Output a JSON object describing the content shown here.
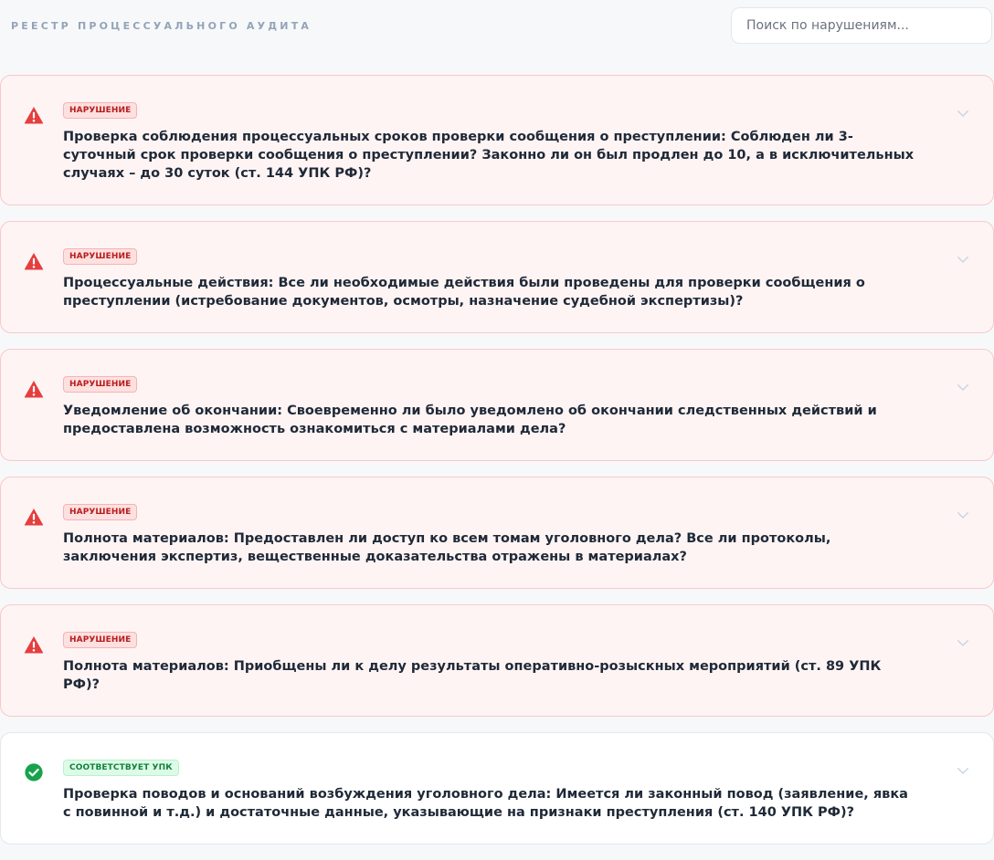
{
  "header": {
    "title": "РЕЕСТР ПРОЦЕССУАЛЬНОГО АУДИТА",
    "search_placeholder": "Поиск по нарушениям..."
  },
  "colors": {
    "violation_icon": "#e53e3e",
    "ok_icon": "#16a34a",
    "chevron": "#cbd5e1"
  },
  "items": [
    {
      "status": "violation",
      "badge": "НАРУШЕНИЕ",
      "text": "Проверка соблюдения процессуальных сроков проверки сообщения о преступлении: Соблюден ли 3-суточный срок проверки сообщения о преступлении? Законно ли он был продлен до 10, а в исключительных случаях – до 30 суток (ст. 144 УПК РФ)?",
      "icon": "warning-triangle-icon"
    },
    {
      "status": "violation",
      "badge": "НАРУШЕНИЕ",
      "text": "Процессуальные действия: Все ли необходимые действия были проведены для проверки сообщения о преступлении (истребование документов, осмотры, назначение судебной экспертизы)?",
      "icon": "warning-triangle-icon"
    },
    {
      "status": "violation",
      "badge": "НАРУШЕНИЕ",
      "text": "Уведомление об окончании: Своевременно ли было уведомлено об окончании следственных действий и предоставлена возможность ознакомиться с материалами дела?",
      "icon": "warning-triangle-icon"
    },
    {
      "status": "violation",
      "badge": "НАРУШЕНИЕ",
      "text": "Полнота материалов: Предоставлен ли доступ ко всем томам уголовного дела? Все ли протоколы, заключения экспертиз, вещественные доказательства отражены в материалах?",
      "icon": "warning-triangle-icon"
    },
    {
      "status": "violation",
      "badge": "НАРУШЕНИЕ",
      "text": "Полнота материалов: Приобщены ли к делу результаты оперативно-розыскных мероприятий (ст. 89 УПК РФ)?",
      "icon": "warning-triangle-icon"
    },
    {
      "status": "ok",
      "badge": "СООТВЕТСТВУЕТ УПК",
      "text": "Проверка поводов и оснований возбуждения уголовного дела: Имеется ли законный повод (заявление, явка с повинной и т.д.) и достаточные данные, указывающие на признаки преступления (ст. 140 УПК РФ)?",
      "icon": "check-circle-icon"
    }
  ]
}
